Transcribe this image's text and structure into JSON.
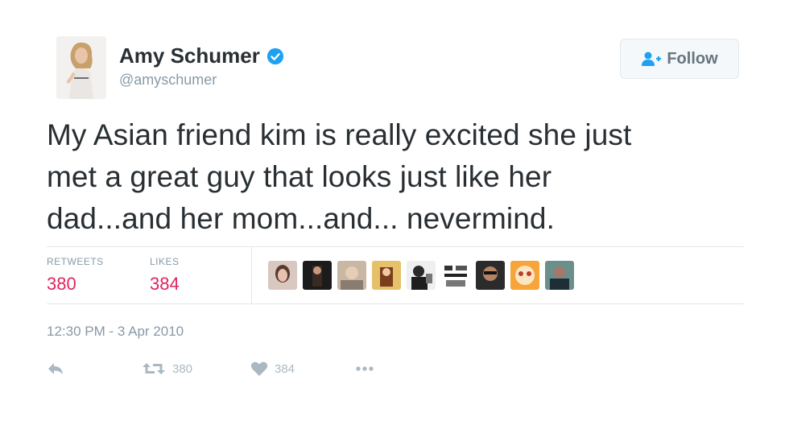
{
  "user": {
    "name": "Amy Schumer",
    "handle": "@amyschumer",
    "avatar_icon": "profile-photo",
    "verified_color": "#1da1f2"
  },
  "follow_button": {
    "label": "Follow",
    "icon": "follow-person-icon"
  },
  "tweet": {
    "lines": [
      "My Asian friend kim is really excited she just",
      "met a great guy that looks just like her",
      "dad...and her mom...and... nevermind."
    ]
  },
  "stats": {
    "retweets_label": "RETWEETS",
    "retweets_value": "380",
    "likes_label": "LIKES",
    "likes_value": "384",
    "accent_color": "#e0245e"
  },
  "timestamp": "12:30 PM - 3 Apr 2010",
  "actions": {
    "reply_icon": "reply-icon",
    "retweet_icon": "retweet-icon",
    "retweet_count": "380",
    "like_icon": "heart-icon",
    "like_count": "384",
    "more_icon": "more-dots-icon"
  }
}
